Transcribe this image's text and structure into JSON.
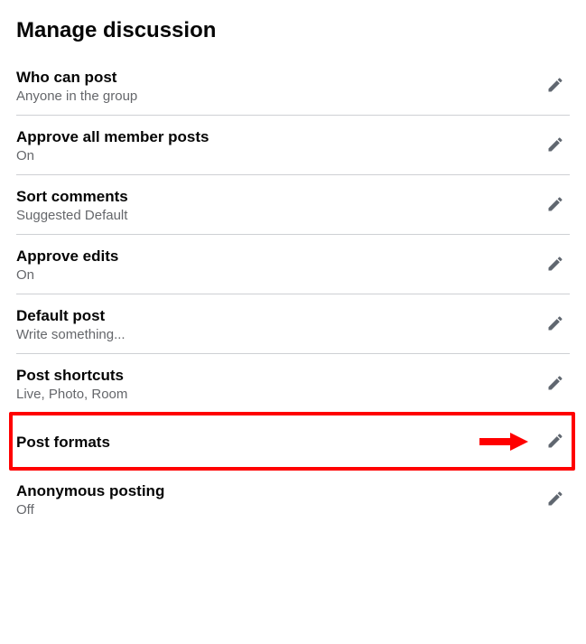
{
  "page_title": "Manage discussion",
  "settings": [
    {
      "title": "Who can post",
      "value": "Anyone in the group"
    },
    {
      "title": "Approve all member posts",
      "value": "On"
    },
    {
      "title": "Sort comments",
      "value": "Suggested Default"
    },
    {
      "title": "Approve edits",
      "value": "On"
    },
    {
      "title": "Default post",
      "value": "Write something..."
    },
    {
      "title": "Post shortcuts",
      "value": "Live, Photo, Room"
    },
    {
      "title": "Post formats",
      "value": ""
    },
    {
      "title": "Anonymous posting",
      "value": "Off"
    }
  ],
  "highlight_index": 6
}
